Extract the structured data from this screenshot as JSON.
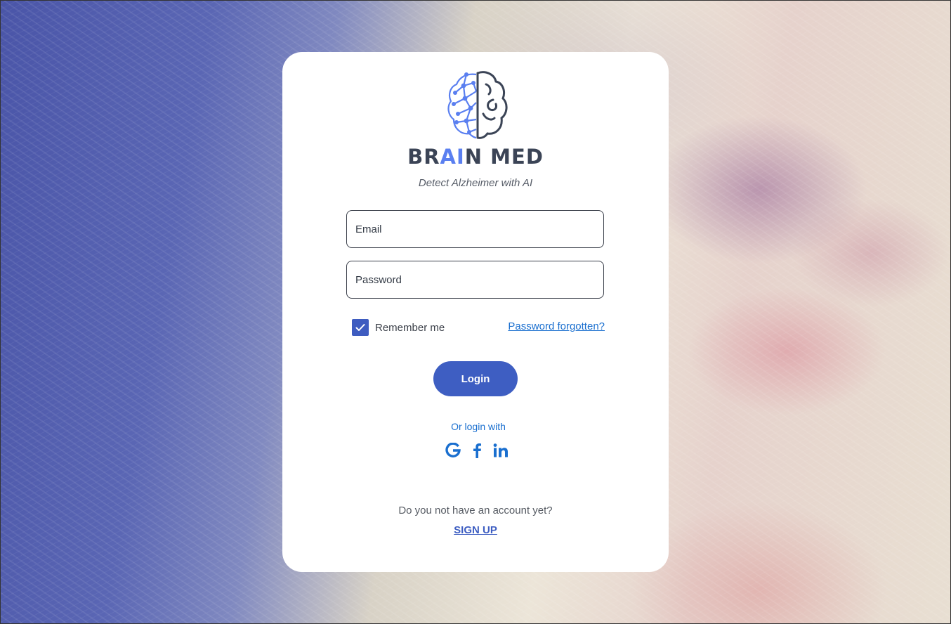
{
  "brand": {
    "name_part1": "BR",
    "name_part2": "AI",
    "name_part3": "N MED",
    "tagline": "Detect  Alzheimer with AI",
    "text_color": "#3b4456",
    "accent_color": "#5a7ff0"
  },
  "form": {
    "email_placeholder": "Email",
    "password_placeholder": "Password",
    "remember_label": "Remember me",
    "remember_checked": true,
    "forgot_label": "Password forgotten?",
    "login_label": "Login",
    "primary_color": "#3e5ec2",
    "link_color": "#1a6fcf"
  },
  "social": {
    "label": "Or login with",
    "providers": [
      {
        "name": "Google",
        "icon": "google-icon"
      },
      {
        "name": "Facebook",
        "icon": "facebook-icon"
      },
      {
        "name": "LinkedIn",
        "icon": "linkedin-icon"
      }
    ]
  },
  "signup": {
    "prompt": "Do you not have an account yet?",
    "label": "SIGN UP"
  }
}
